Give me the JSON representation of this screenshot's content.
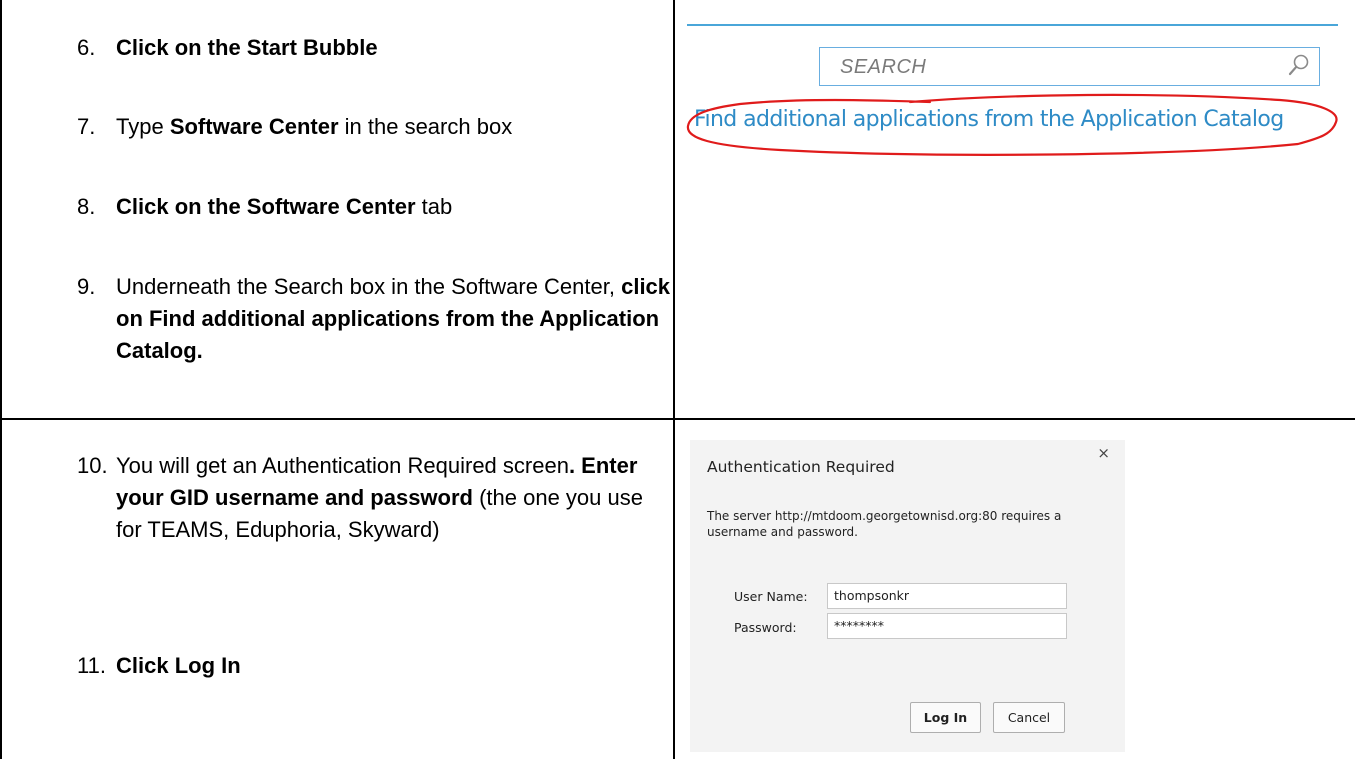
{
  "steps": [
    {
      "num": "6.",
      "parts": [
        {
          "b": true,
          "t": "Click on the Start Bubble"
        }
      ]
    },
    {
      "num": "7.",
      "parts": [
        {
          "b": false,
          "t": "Type "
        },
        {
          "b": true,
          "t": "Software Center"
        },
        {
          "b": false,
          "t": " in the search box"
        }
      ]
    },
    {
      "num": "8.",
      "parts": [
        {
          "b": true,
          "t": "Click on the Software Center"
        },
        {
          "b": false,
          "t": " tab"
        }
      ]
    },
    {
      "num": "9.",
      "parts": [
        {
          "b": false,
          "t": "Underneath the Search box in the Software Center, "
        },
        {
          "b": true,
          "t": "click on Find additional applications from the Application Catalog."
        }
      ]
    },
    {
      "num": "10.",
      "parts": [
        {
          "b": false,
          "t": "You will get an Authentication Required screen"
        },
        {
          "b": true,
          "t": ".  Enter your GID username and password"
        },
        {
          "b": false,
          "t": " (the one you use for TEAMS, Eduphoria, Skyward)"
        }
      ]
    },
    {
      "num": "11.",
      "parts": [
        {
          "b": true,
          "t": "Click Log In"
        }
      ]
    }
  ],
  "software_center": {
    "search_placeholder": "SEARCH",
    "search_icon": "magnifier-icon",
    "catalog_link": "Find additional applications from the Application Catalog",
    "accent_color": "#4aa6d9",
    "link_color": "#2e8bc6",
    "annotation_color": "#e01b1b"
  },
  "auth_dialog": {
    "title": "Authentication Required",
    "close_glyph": "×",
    "message": "The server http://mtdoom.georgetownisd.org:80 requires a username and password.",
    "username_label": "User Name:",
    "username_value": "thompsonkr",
    "password_label": "Password:",
    "password_value": "********",
    "login_button": "Log In",
    "cancel_button": "Cancel"
  }
}
